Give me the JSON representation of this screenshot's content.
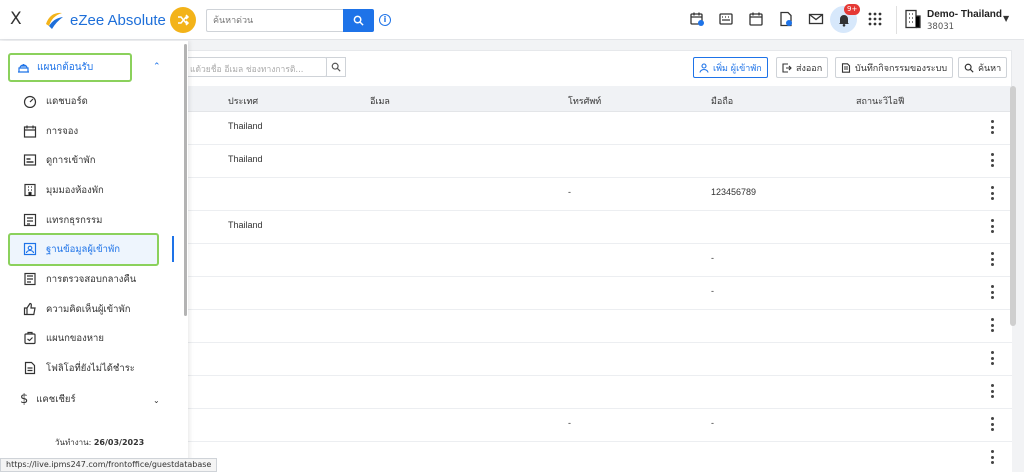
{
  "topbar": {
    "close_label": "X",
    "app_name": "eZee Absolute",
    "search_placeholder": "ค้นหาด่วน",
    "notification_badge": "9+",
    "property_name": "Demo- Thailand",
    "property_code": "38031"
  },
  "toolbar": {
    "filter_placeholder": "แด้วยชื่อ อีเมล ช่องทางการติ...",
    "add_guest": "เพิ่ม ผู้เข้าพัก",
    "export": "ส่งออก",
    "audit_log": "บันทึกกิจกรรมของระบบ",
    "search": "ค้นหา"
  },
  "table": {
    "headers": {
      "country": "ประเทศ",
      "email": "อีเมล",
      "phone": "โทรศัพท์",
      "mobile": "มือถือ",
      "wifi_status": "สถานะวิไอฟี"
    },
    "rows": [
      {
        "country": "Thailand",
        "phone": "",
        "mobile": ""
      },
      {
        "country": "Thailand",
        "phone": "",
        "mobile": ""
      },
      {
        "country": "",
        "phone": "-",
        "mobile": "123456789"
      },
      {
        "country": "Thailand",
        "phone": "",
        "mobile": ""
      },
      {
        "country": "",
        "phone": "",
        "mobile": "-"
      },
      {
        "country": "",
        "phone": "",
        "mobile": "-"
      },
      {
        "country": "",
        "phone": "",
        "mobile": ""
      },
      {
        "country": "",
        "phone": "",
        "mobile": ""
      },
      {
        "country": "",
        "phone": "",
        "mobile": ""
      },
      {
        "country": "",
        "phone": "-",
        "mobile": "-"
      },
      {
        "country": "",
        "phone": "",
        "mobile": ""
      }
    ]
  },
  "sidebar": {
    "section_label": "แผนกต้อนรับ",
    "items": [
      {
        "label": "แดชบอร์ด",
        "icon": "dashboard-icon"
      },
      {
        "label": "การจอง",
        "icon": "calendar-icon"
      },
      {
        "label": "ดูการเข้าพัก",
        "icon": "stay-view-icon"
      },
      {
        "label": "มุมมองห้องพัก",
        "icon": "room-view-icon"
      },
      {
        "label": "แทรกธุรกรรม",
        "icon": "transaction-icon"
      },
      {
        "label": "ฐานข้อมูลผู้เข้าพัก",
        "icon": "guest-database-icon"
      },
      {
        "label": "การตรวจสอบกลางคืน",
        "icon": "night-audit-icon"
      },
      {
        "label": "ความคิดเห็นผู้เข้าพัก",
        "icon": "thumbs-up-icon"
      },
      {
        "label": "แผนกของหาย",
        "icon": "lost-found-icon"
      },
      {
        "label": "โฟลิโอที่ยังไม่ได้ชำระ",
        "icon": "folio-icon"
      }
    ],
    "cashier_label": "แคชเชียร์",
    "workday_label": "วันทำงาน:",
    "workday_value": "26/03/2023"
  },
  "status_url": "https://live.ipms247.com/frontoffice/guestdatabase",
  "colors": {
    "accent": "#1e73e8",
    "highlight": "#8bd15c",
    "shuffle": "#f3b319"
  }
}
